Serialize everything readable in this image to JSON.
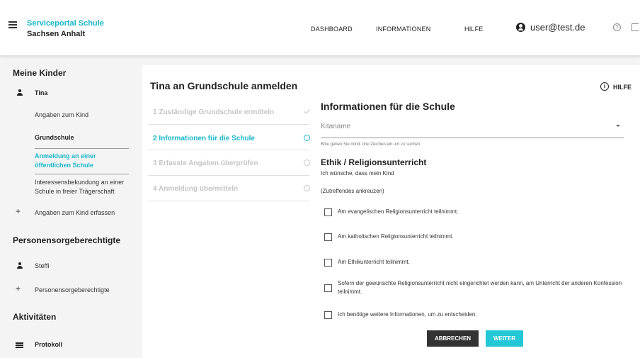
{
  "header": {
    "brand_line1": "Serviceportal Schule",
    "brand_line2": "Sachsen Anhalt",
    "nav": [
      "DASHBOARD",
      "INFORMATIONEN",
      "HILFE"
    ],
    "user": "user@test.de"
  },
  "sidebar": {
    "section_kinder": "Meine Kinder",
    "child_name": "Tina",
    "item_angaben": "Angaben zum Kind",
    "item_grundschule": "Grundschule",
    "item_anmeldung_1": "Anmeldung an einer",
    "item_anmeldung_2": "öffentlichen Schule",
    "item_interesse_1": "Interessensbekundung an einer",
    "item_interesse_2": "Schule in freier Trägerschaft",
    "item_add_child": "Angaben zum Kind erfassen",
    "section_pers": "Personensorgeberechtigte",
    "pers_name": "Steffi",
    "item_add_pers": "Personensorgeberechtigte",
    "section_akt": "Aktivitäten",
    "item_protokoll": "Protokoll"
  },
  "card": {
    "title": "Tina an Grundschule anmelden",
    "help_label": "HILFE",
    "steps": [
      "1 Zuständige Grundschule ermitteln",
      "2 Informationen für die Schule",
      "3 Erfasste Angaben überprüfen",
      "4 Anmeldung übermitteln"
    ],
    "section_title": "Informationen für die Schule",
    "kita_placeholder": "Kitaname",
    "kita_hint": "Bitte geben Sie mind. drei Zeichen ein um zu suchen",
    "ethik_title": "Ethik / Religionsunterricht",
    "intro": "Ich wünsche, dass mein Kind",
    "instruction": "(Zutreffendes ankreuzen)",
    "options": [
      "Am evangelischen Religionsunterricht teilnimmt.",
      "Am katholischen Religionsunterricht teilnimmt.",
      "Am Ethikunterricht teilnimmt.",
      "Sofern der gewünschte Religionsunterricht nicht eingerichtet werden kann, am Unterricht der anderen Konfession teilnimmt.",
      "Ich benötige weitere Informationen, um zu entscheiden."
    ],
    "btn_cancel": "ABBRECHEN",
    "btn_next": "WEITER"
  },
  "colors": {
    "accent": "#19b6c8",
    "button_dark": "#333333",
    "button_accent": "#24c7d6"
  }
}
